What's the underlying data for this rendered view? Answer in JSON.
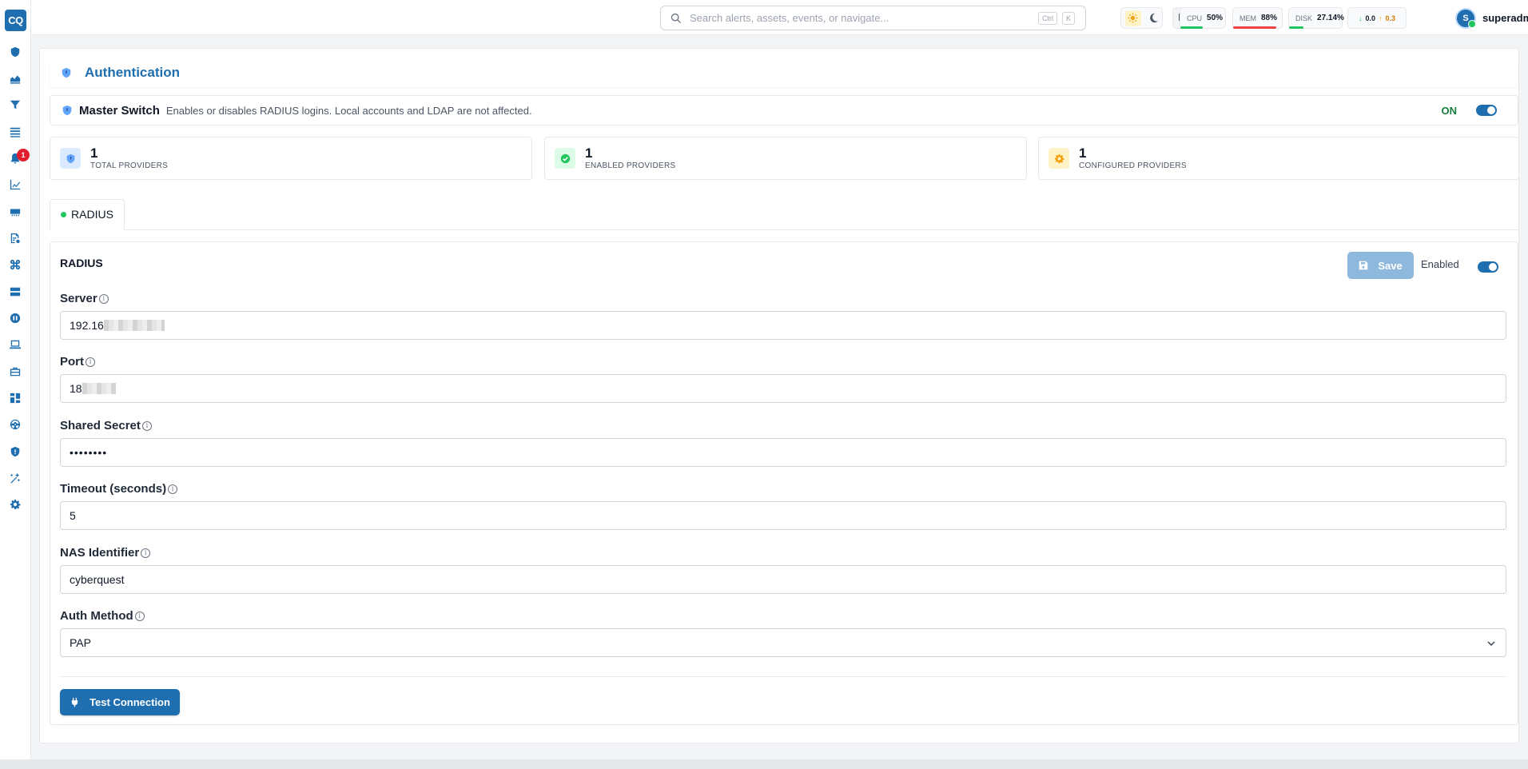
{
  "app": {
    "logo_text": "CQ",
    "notification_count": "1"
  },
  "search": {
    "placeholder": "Search alerts, assets, events, or navigate...",
    "shortcut_ctrl": "Ctrl",
    "shortcut_key": "K"
  },
  "metrics": {
    "cpu": {
      "label": "CPU",
      "value": "50%",
      "fill": 0.5,
      "color": "#22c55e"
    },
    "mem": {
      "label": "MEM",
      "value": "88%",
      "fill": 0.88,
      "color": "#ef4444"
    },
    "disk": {
      "label": "DISK",
      "value": "27.14%",
      "fill": 0.27,
      "color": "#22c55e"
    },
    "net": {
      "down": "0.0",
      "up": "0.3"
    }
  },
  "user": {
    "initial": "S",
    "name": "superadmin"
  },
  "page": {
    "title": "Authentication"
  },
  "master_switch": {
    "title": "Master Switch",
    "description": "Enables or disables RADIUS logins. Local accounts and LDAP are not affected.",
    "state_label": "ON"
  },
  "stats": [
    {
      "value": "1",
      "label": "TOTAL PROVIDERS"
    },
    {
      "value": "1",
      "label": "ENABLED PROVIDERS"
    },
    {
      "value": "1",
      "label": "CONFIGURED PROVIDERS"
    }
  ],
  "tabs": [
    {
      "label": "RADIUS"
    }
  ],
  "radius": {
    "title": "RADIUS",
    "save_label": "Save",
    "enabled_label": "Enabled",
    "fields": {
      "server": {
        "label": "Server",
        "value": "192.16"
      },
      "port": {
        "label": "Port",
        "value": "18"
      },
      "secret": {
        "label": "Shared Secret",
        "value": "••••••••"
      },
      "timeout": {
        "label": "Timeout (seconds)",
        "value": "5"
      },
      "nas": {
        "label": "NAS Identifier",
        "value": "cyberquest"
      },
      "auth": {
        "label": "Auth Method",
        "value": "PAP"
      }
    },
    "test_label": "Test Connection"
  },
  "colors": {
    "accent": "#1f6fb0",
    "success": "#22c55e",
    "danger": "#ef4444",
    "warning": "#f59e0b"
  }
}
